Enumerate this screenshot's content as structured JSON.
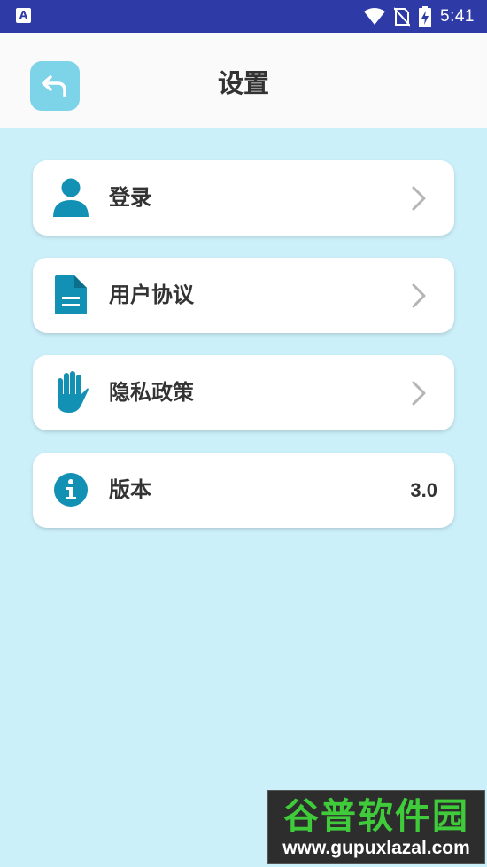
{
  "status_bar": {
    "app_icon": "A",
    "time": "5:41",
    "icons": [
      "wifi-icon",
      "no-sim-icon",
      "battery-charging-icon"
    ]
  },
  "header": {
    "title": "设置",
    "back_icon": "back-arrow-icon"
  },
  "menu": {
    "items": [
      {
        "label": "登录",
        "icon": "user-icon",
        "chevron": true
      },
      {
        "label": "用户协议",
        "icon": "document-icon",
        "chevron": true
      },
      {
        "label": "隐私政策",
        "icon": "hand-icon",
        "chevron": true
      },
      {
        "label": "版本",
        "icon": "info-icon",
        "value": "3.0"
      }
    ]
  },
  "watermark": {
    "title": "谷普软件园",
    "url": "www.gupuxlazal.com"
  },
  "colors": {
    "status_bar": "#2e3aa5",
    "header_bg": "#fafafa",
    "page_bg": "#ccf0fa",
    "accent": "#1291b4",
    "back_button": "#7dd3e7"
  }
}
